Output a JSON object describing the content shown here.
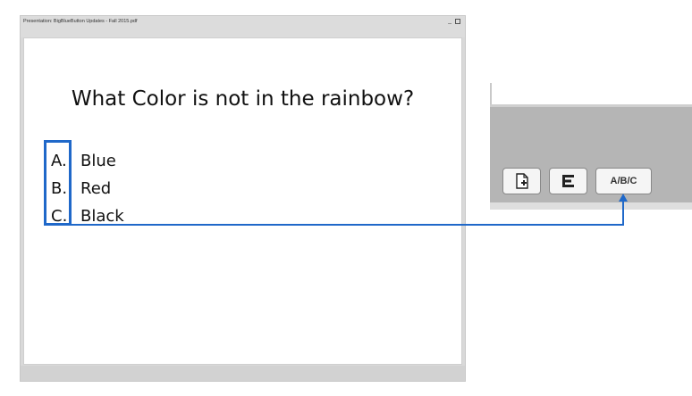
{
  "presentation": {
    "window_title": "Presentation: BigBlueButton Updates  - Fall 2015.pdf",
    "minimize_label": "_",
    "slide": {
      "title": "What Color is not in the rainbow?",
      "answers": [
        {
          "letter": "A.",
          "text": "Blue"
        },
        {
          "letter": "B.",
          "text": "Red"
        },
        {
          "letter": "C.",
          "text": "Black"
        }
      ]
    }
  },
  "toolbar": {
    "buttons": [
      {
        "id": "upload",
        "icon": "upload-document-icon"
      },
      {
        "id": "bars",
        "icon": "bar-chart-icon"
      },
      {
        "id": "poll",
        "label": "A/B/C"
      }
    ]
  },
  "annotation": {
    "highlight_color": "#1f68c9"
  }
}
